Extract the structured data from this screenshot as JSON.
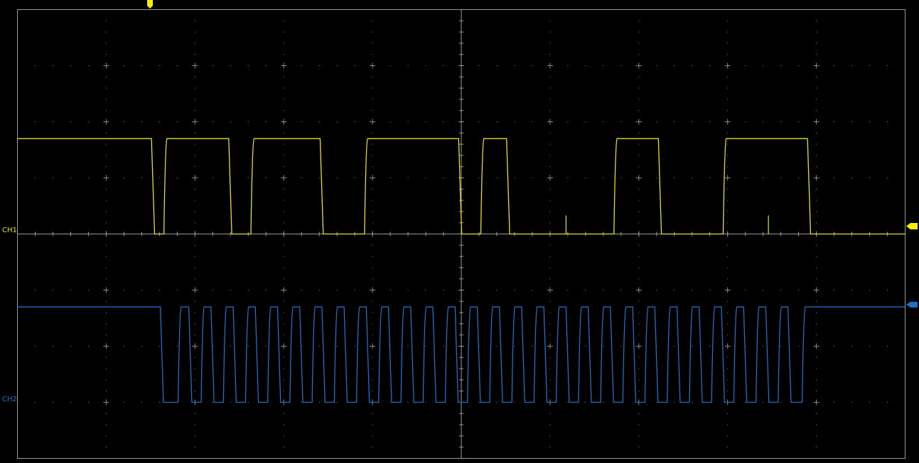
{
  "channels": [
    {
      "label": "CH1",
      "color": "#e8e020"
    },
    {
      "label": "CH2",
      "color": "#1e6fc8"
    }
  ],
  "grid": {
    "divisions_x": 10,
    "divisions_y": 8,
    "color": "#8a8a8a"
  },
  "trigger_color": "#f2f200",
  "chart_data": {
    "type": "line",
    "xlim": [
      0,
      10
    ],
    "ylim": [
      -4,
      4
    ],
    "grid": true,
    "series": [
      {
        "name": "CH1",
        "color": "#e8e020",
        "baseline": 0,
        "high": 1.7,
        "low": 0,
        "initial": 1.7,
        "transitions": [
          1.51,
          1.65,
          2.38,
          2.63,
          3.41,
          3.91,
          4.97,
          5.22,
          5.51,
          6.72,
          7.22,
          7.95,
          8.9
        ],
        "spikes": [
          6.18,
          8.46
        ]
      },
      {
        "name": "CH2",
        "color": "#1e6fc8",
        "baseline": -3,
        "high": -1.3,
        "low": -3,
        "initial": -1.3,
        "transitions": [
          1.61,
          1.81,
          1.93,
          2.07,
          2.18,
          2.32,
          2.43,
          2.57,
          2.68,
          2.82,
          2.93,
          3.07,
          3.18,
          3.32,
          3.43,
          3.57,
          3.68,
          3.82,
          3.93,
          4.07,
          4.18,
          4.32,
          4.43,
          4.57,
          4.68,
          4.82,
          4.93,
          5.07,
          5.18,
          5.32,
          5.43,
          5.57,
          5.68,
          5.82,
          5.93,
          6.07,
          6.18,
          6.32,
          6.43,
          6.57,
          6.68,
          6.82,
          6.93,
          7.07,
          7.18,
          7.32,
          7.43,
          7.57,
          7.68,
          7.82,
          7.93,
          8.07,
          8.18,
          8.32,
          8.43,
          8.57,
          8.68,
          8.84
        ]
      }
    ]
  }
}
